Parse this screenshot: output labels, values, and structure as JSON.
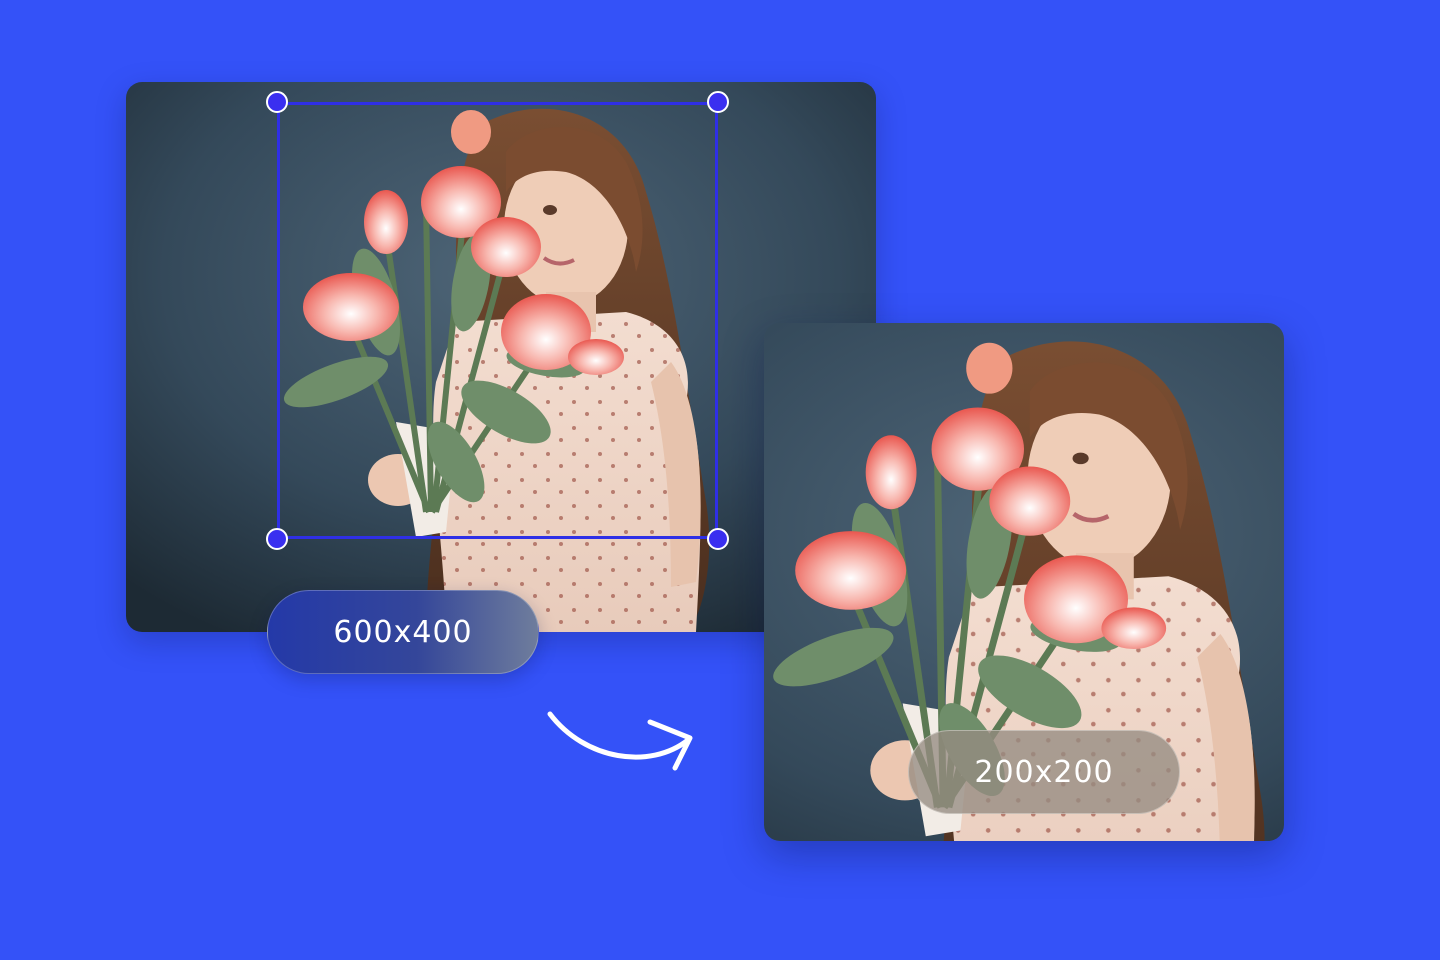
{
  "source_image": {
    "size_label": "600x400"
  },
  "result_image": {
    "size_label": "200x200"
  },
  "colors": {
    "background": "#3452F8",
    "crop_border": "#2f2fe6",
    "handle_fill": "#3a2ff0",
    "pill_text": "#ffffff"
  },
  "icons": {
    "arrow": "curved-arrow-right-icon",
    "handles": "crop-handle"
  }
}
